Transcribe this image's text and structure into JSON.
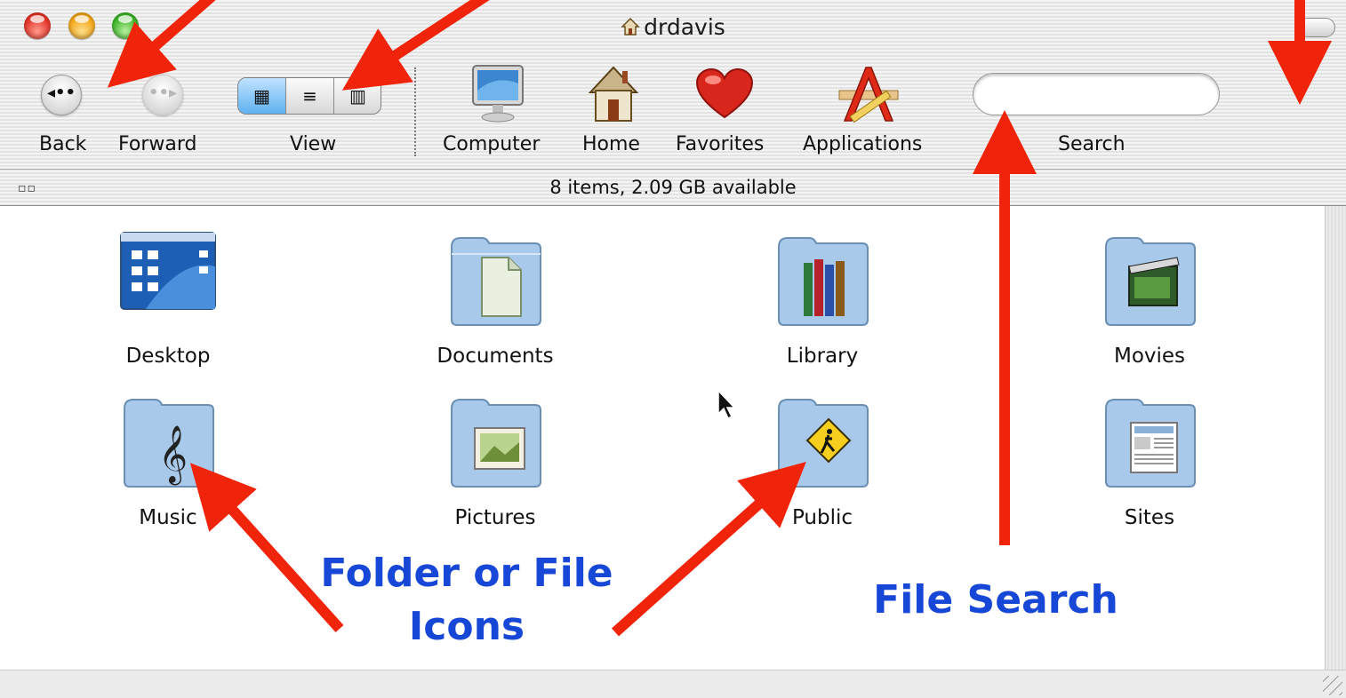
{
  "window": {
    "title": "drdavis"
  },
  "toolbar": {
    "back_label": "Back",
    "forward_label": "Forward",
    "view_label": "View",
    "computer_label": "Computer",
    "home_label": "Home",
    "favorites_label": "Favorites",
    "applications_label": "Applications",
    "search_label": "Search",
    "search_value": ""
  },
  "status": {
    "text": "8 items, 2.09 GB available"
  },
  "items": [
    {
      "label": "Desktop",
      "icon": "desktop-icon"
    },
    {
      "label": "Documents",
      "icon": "documents-folder-icon"
    },
    {
      "label": "Library",
      "icon": "library-folder-icon"
    },
    {
      "label": "Movies",
      "icon": "movies-folder-icon"
    },
    {
      "label": "Music",
      "icon": "music-folder-icon"
    },
    {
      "label": "Pictures",
      "icon": "pictures-folder-icon"
    },
    {
      "label": "Public",
      "icon": "public-folder-icon"
    },
    {
      "label": "Sites",
      "icon": "sites-folder-icon"
    }
  ],
  "annotations": {
    "folder_icons_line1": "Folder or File",
    "folder_icons_line2": "Icons",
    "file_search": "File Search"
  },
  "colors": {
    "annotation_text": "#1747d6",
    "arrow": "#f0240a",
    "view_selected": "#5fb1f0"
  }
}
